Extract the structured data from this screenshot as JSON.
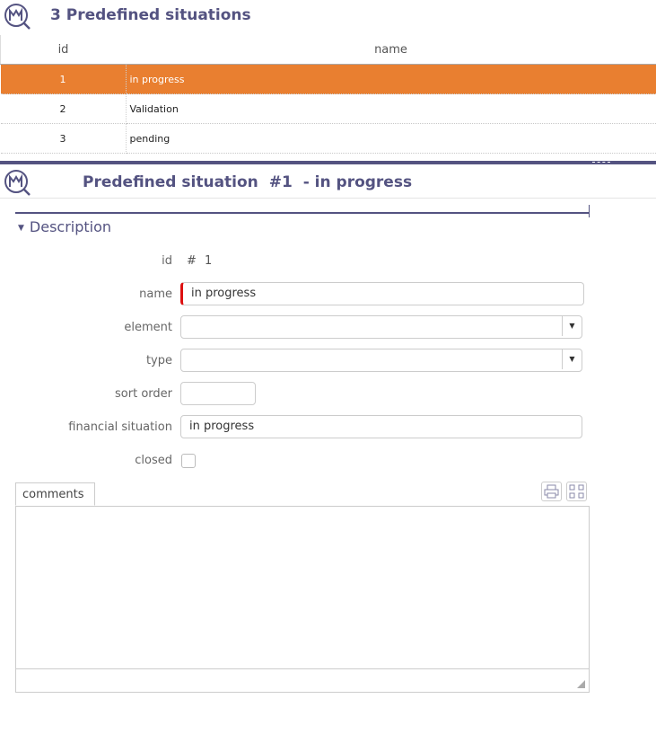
{
  "list": {
    "title": "3 Predefined situations",
    "logo_icon": "planning-chart-icon",
    "columns": [
      "id",
      "name"
    ],
    "rows": [
      {
        "id": "1",
        "name": "in progress",
        "selected": true
      },
      {
        "id": "2",
        "name": "Validation",
        "selected": false
      },
      {
        "id": "3",
        "name": "pending",
        "selected": false
      }
    ],
    "selected_row_color": "#e97f30"
  },
  "detail": {
    "title_prefix": "Predefined situation",
    "title_id": "#1",
    "title_name": "- in progress",
    "accent_color": "#545381",
    "section": {
      "label": "Description",
      "expanded": true
    },
    "fields": {
      "id_label": "id",
      "id_hash": "#",
      "id_value": "1",
      "name_label": "name",
      "name_value": "in progress",
      "element_label": "element",
      "element_value": "",
      "type_label": "type",
      "type_value": "",
      "sort_order_label": "sort order",
      "sort_order_value": "",
      "financial_situation_label": "financial situation",
      "financial_situation_value": "in progress",
      "closed_label": "closed",
      "closed_checked": false
    },
    "comments": {
      "tab_label": "comments",
      "value": "",
      "print_icon": "printer-icon",
      "expand_icon": "fullscreen-icon"
    }
  }
}
